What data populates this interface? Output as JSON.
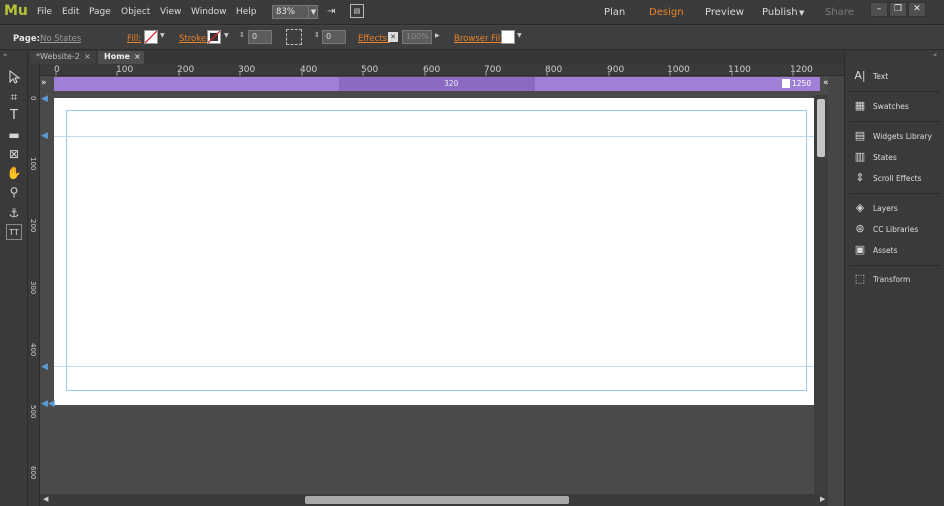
{
  "app": {
    "logo": "Mu"
  },
  "menubar": {
    "items": [
      "File",
      "Edit",
      "Page",
      "Object",
      "View",
      "Window",
      "Help"
    ],
    "zoom": "83%",
    "modes": [
      "Plan",
      "Design",
      "Preview",
      "Publish",
      "Share"
    ],
    "publish_caret": "▼",
    "active_mode": "Design"
  },
  "controlbar": {
    "page_label": "Page:",
    "page_value": "No States",
    "fill_label": "Fill:",
    "stroke_label": "Stroke:",
    "stroke_width": "0",
    "corner_radius": "0",
    "effects_label": "Effects:",
    "opacity": "100%",
    "browser_fill_label": "Browser Fill:"
  },
  "tabs": [
    {
      "label": "*Website-2",
      "close": "×"
    },
    {
      "label": "Home",
      "close": "×"
    }
  ],
  "rulers": {
    "h_ticks": [
      "0",
      "100",
      "200",
      "300",
      "400",
      "500",
      "600",
      "700",
      "800",
      "900",
      "1000",
      "1100",
      "1200"
    ],
    "v_ticks": [
      "0",
      "100",
      "200",
      "300",
      "400",
      "500",
      "600"
    ]
  },
  "breakpoint": {
    "value": "320",
    "end_value": "1250"
  },
  "panels": [
    {
      "label": "Text",
      "icon": "text-icon",
      "glyph": "A|"
    },
    {
      "label": "Swatches",
      "icon": "swatches-icon",
      "glyph": "▦"
    },
    {
      "label": "Widgets Library",
      "icon": "widgets-icon",
      "glyph": "▤"
    },
    {
      "label": "States",
      "icon": "states-icon",
      "glyph": "▥"
    },
    {
      "label": "Scroll Effects",
      "icon": "scroll-effects-icon",
      "glyph": "⇕"
    },
    {
      "label": "Layers",
      "icon": "layers-icon",
      "glyph": "◈"
    },
    {
      "label": "CC Libraries",
      "icon": "cc-libraries-icon",
      "glyph": "⊛"
    },
    {
      "label": "Assets",
      "icon": "assets-icon",
      "glyph": "▣"
    },
    {
      "label": "Transform",
      "icon": "transform-icon",
      "glyph": "⬚"
    }
  ],
  "colors": {
    "accent": "#e8832a",
    "logo": "#b7c13a",
    "breakpoint": "#a07fd6",
    "guide": "#9cc9f0"
  }
}
